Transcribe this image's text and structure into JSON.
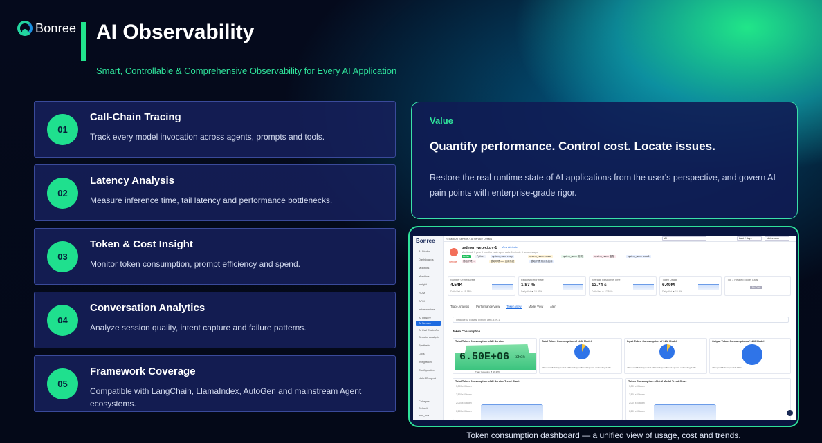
{
  "brand": {
    "logo_text": "Bonree"
  },
  "header": {
    "title": "AI Observability",
    "subtitle": "Smart, Controllable & Comprehensive Observability for Every AI Application"
  },
  "features": [
    {
      "num": "01",
      "title": "Call-Chain Tracing",
      "desc": "Track every model invocation across agents, prompts and tools."
    },
    {
      "num": "02",
      "title": "Latency Analysis",
      "desc": "Measure inference time, tail latency and performance bottlenecks."
    },
    {
      "num": "03",
      "title": "Token & Cost Insight",
      "desc": "Monitor token consumption, prompt efficiency and spend."
    },
    {
      "num": "04",
      "title": "Conversation Analytics",
      "desc": "Analyze session quality, intent capture and failure patterns."
    },
    {
      "num": "05",
      "title": "Framework Coverage",
      "desc": "Compatible with LangChain, LlamaIndex, AutoGen and mainstream Agent ecosystems."
    }
  ],
  "value": {
    "label": "Value",
    "headline": "Quantify performance. Control cost. Locate issues.",
    "body": "Restore the real runtime state of AI applications from the user's perspective, and govern AI pain points with enterprise-grade rigor."
  },
  "caption": "Token consumption dashboard — a unified view of usage, cost and trends.",
  "dashboard": {
    "logo": "Bonree",
    "breadcrumb": "< Back    AI Service  /  AI Service Details",
    "top_selects": [
      "All",
      "Last 2 days",
      "Not refresh"
    ],
    "sidebar": [
      "AI Studio",
      "Dashboards",
      "Monitors",
      "Monitors",
      "Insight",
      "RUM",
      "APM",
      "Infrastructure",
      "AI Observ",
      "AI Service",
      "AI Call Chain An",
      "Session Analysis",
      "Synthetic",
      "Logs",
      "Integration",
      "Configuration",
      "Help&Support"
    ],
    "sidebar_footer": [
      "Collapse",
      "Default",
      "one_dev"
    ],
    "service_name": "python_web-ci.py-1",
    "service_link": "View Attribute",
    "service_meta": "Monitored:  1 year 9 months     Last report data:  1 minute 3 seconds ago",
    "service_badge": "Service",
    "tags": [
      "Active",
      "Python",
      "system_name env:p",
      "system_name:course",
      "system_name 测试",
      "system_name 金融",
      "system_name area 1",
      "基础环境 ...",
      "基础环境 ecs 应用系统",
      "基础环境 测试系统商"
    ],
    "kpis": [
      {
        "label": "Number Of Requests",
        "value": "4.54K",
        "sub": "Daily Net ▼ 15.18%"
      },
      {
        "label": "Request Error Rate",
        "value": "1.87 %",
        "sub": "Daily Net ▼ 10.29%"
      },
      {
        "label": "Average Response Time",
        "value": "13.74 s",
        "sub": "Daily Net ▼ 17.54%"
      },
      {
        "label": "Token Usage",
        "value": "6.49M",
        "sub": "Daily Net ▼ 16.8%"
      },
      {
        "label": "Top 3 Related Model Calls",
        "value": "",
        "sub": "No Data"
      }
    ],
    "tabs": [
      "Trace Analysis",
      "Performance View",
      "Token View",
      "Model View",
      "Alert"
    ],
    "active_tab": "Token View",
    "filter": "Instance ID Equals:  python_web-ci.py-1",
    "section": "Token Consumption",
    "panels": [
      {
        "title": "Total Token Consumption of AI Service",
        "value": "6.50E+06",
        "unit": "token",
        "sub": "Than Yesterday  ▼ 16.37%"
      },
      {
        "title": "Total Token Consumption of LLM Model",
        "legend": "aiRequestModel:\"qwen2.5 0.5b\"   aiRequestModel:\"qwen3-embedding 0.6b\""
      },
      {
        "title": "Input Token Consumption of LLM Model",
        "legend": "aiRequestModel:\"qwen2.5 0.5b\"   aiRequestModel:\"qwen3-embedding 0.6b\""
      },
      {
        "title": "Output Token Consumption of LLM Model",
        "legend": "aiRequestModel:\"qwen2.5 0.5b\""
      }
    ],
    "trends": [
      {
        "title": "Total Token Consumption of AI Service Trend Chart",
        "yticks": [
          "3,000 x10 token",
          "2,500 x10 token",
          "2,000 x10 token",
          "1,500 x10 token"
        ]
      },
      {
        "title": "Token Consumption of LLM Model Trend Chart",
        "yticks": [
          "3,000 x10 token",
          "2,500 x10 token",
          "2,000 x10 token",
          "1,500 x10 token"
        ]
      }
    ]
  }
}
